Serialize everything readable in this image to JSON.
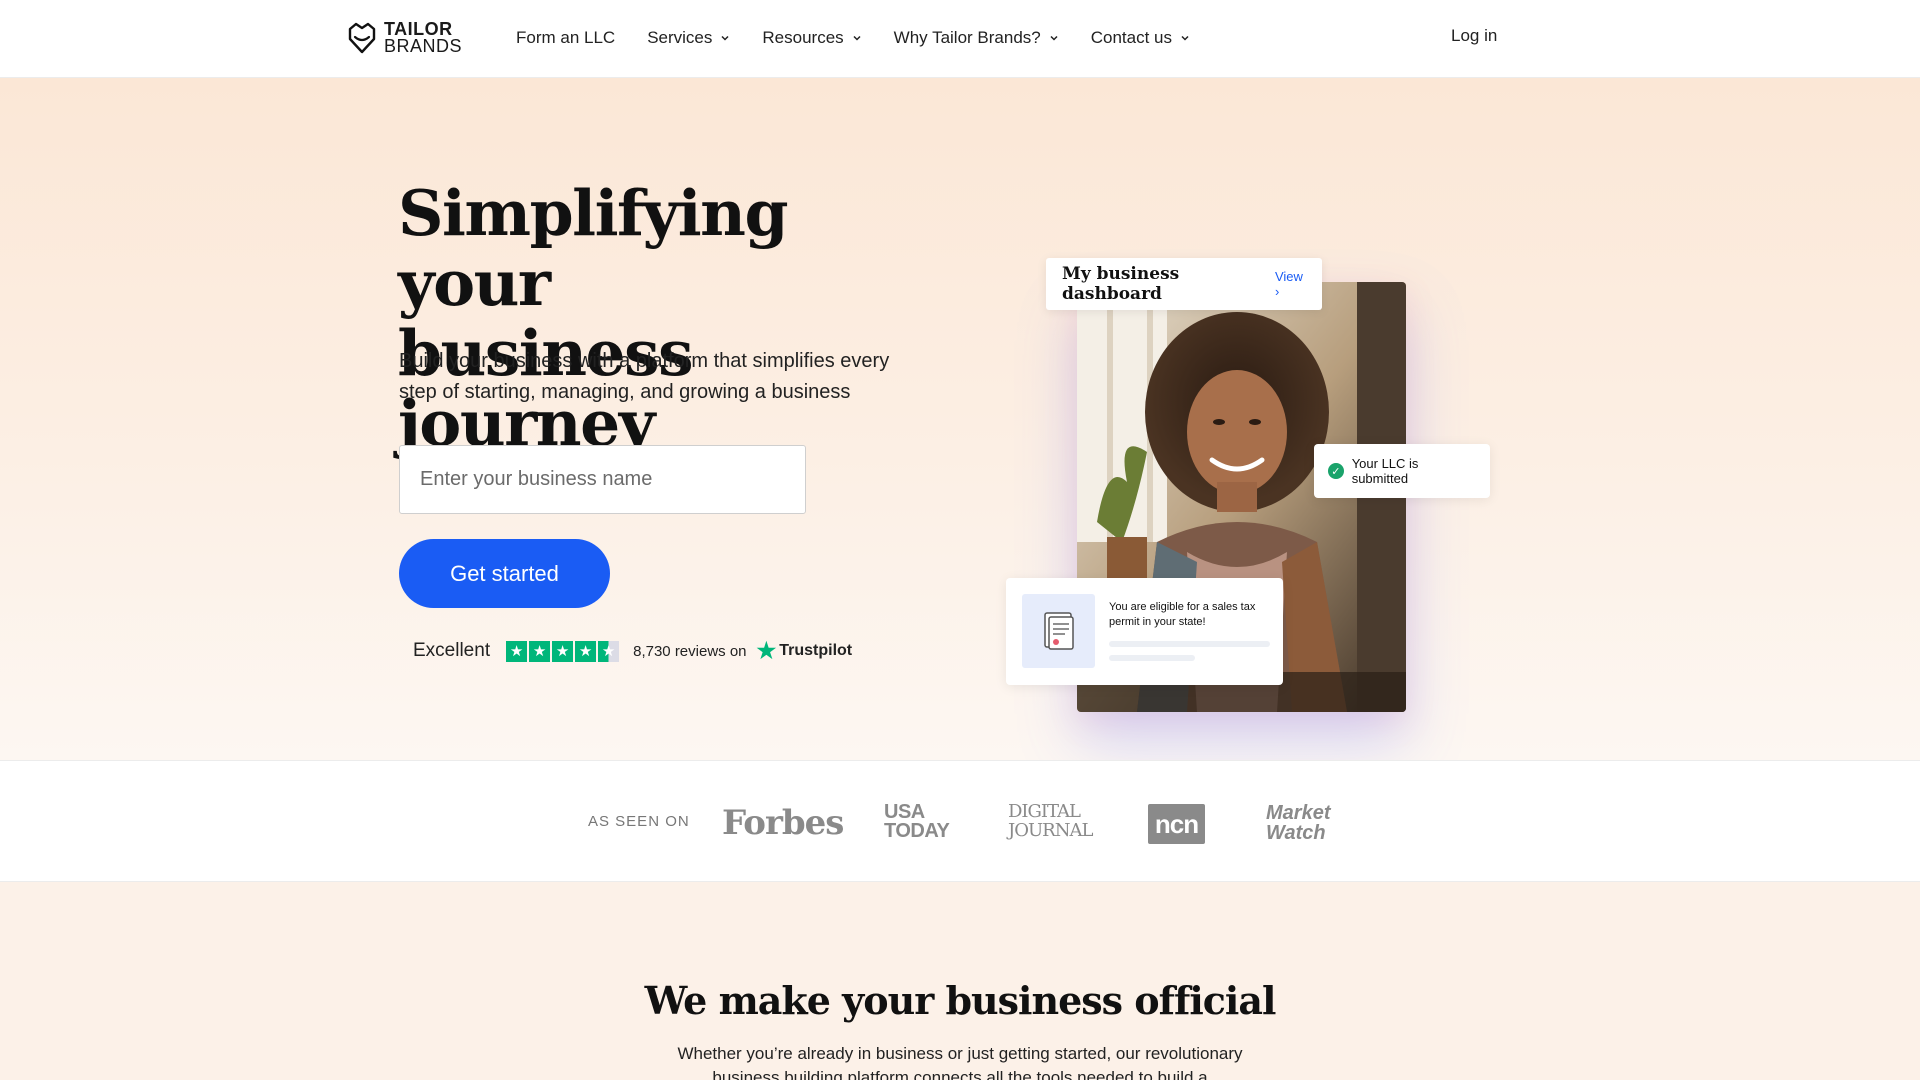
{
  "nav": {
    "logo_line1": "TAILOR",
    "logo_line2": "BRANDS",
    "links": [
      {
        "label": "Form an LLC",
        "dropdown": false
      },
      {
        "label": "Services",
        "dropdown": true
      },
      {
        "label": "Resources",
        "dropdown": true
      },
      {
        "label": "Why Tailor Brands?",
        "dropdown": true
      },
      {
        "label": "Contact us",
        "dropdown": true
      }
    ],
    "login": "Log in"
  },
  "hero": {
    "title_line1": "Simplifying your",
    "title_line2": "business journey",
    "subtitle": "Build your business with a platform that simplifies every step of starting, managing, and growing a business",
    "input_placeholder": "Enter your business name",
    "cta": "Get started",
    "trustpilot": {
      "rating_word": "Excellent",
      "stars": 4.5,
      "reviews": "8,730 reviews on",
      "brand": "Trustpilot"
    },
    "dashboard_card": {
      "title": "My business dashboard",
      "link": "View ›"
    },
    "llc_card": "Your LLC is submitted",
    "tax_card": "You are eligible for a sales tax permit in your state!"
  },
  "press": {
    "label": "AS SEEN ON",
    "logos": {
      "forbes": "Forbes",
      "usa_today_1": "USA",
      "usa_today_2": "TODAY",
      "digital_journal_1": "DIGITAL",
      "digital_journal_2": "JOURNAL",
      "ncn": "ncn",
      "marketwatch_1": "Market",
      "marketwatch_2": "Watch"
    }
  },
  "official": {
    "title": "We make your business official",
    "subtitle": "Whether you’re already in business or just getting started, our revolutionary business building platform connects all the tools needed to build a"
  },
  "colors": {
    "accent": "#1a5cf4",
    "trustpilot_green": "#00b67a",
    "hero_bg": "#fbe7d6"
  }
}
